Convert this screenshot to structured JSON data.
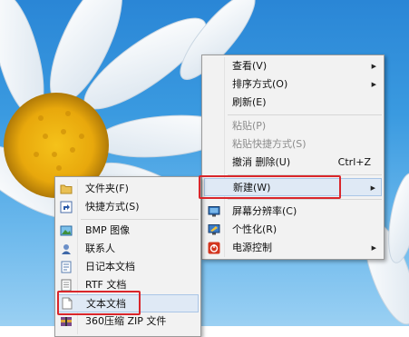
{
  "context_menu": {
    "items": [
      {
        "label": "查看(V)",
        "submenu": true
      },
      {
        "label": "排序方式(O)",
        "submenu": true
      },
      {
        "label": "刷新(E)"
      },
      {
        "label": "粘贴(P)",
        "disabled": true
      },
      {
        "label": "粘贴快捷方式(S)",
        "disabled": true
      },
      {
        "label": "撤消 删除(U)",
        "shortcut": "Ctrl+Z"
      },
      {
        "label": "新建(W)",
        "submenu": true,
        "highlighted": true
      },
      {
        "label": "屏幕分辨率(C)",
        "icon": "display-icon"
      },
      {
        "label": "个性化(R)",
        "icon": "personalize-icon"
      },
      {
        "label": "电源控制",
        "icon": "power-icon",
        "submenu": true
      }
    ]
  },
  "new_submenu": {
    "items": [
      {
        "label": "文件夹(F)",
        "icon": "folder-icon"
      },
      {
        "label": "快捷方式(S)",
        "icon": "shortcut-icon"
      },
      {
        "label": "BMP 图像",
        "icon": "bmp-image-icon"
      },
      {
        "label": "联系人",
        "icon": "contact-icon"
      },
      {
        "label": "日记本文档",
        "icon": "journal-icon"
      },
      {
        "label": "RTF 文档",
        "icon": "rtf-icon"
      },
      {
        "label": "文本文档",
        "icon": "text-document-icon",
        "highlighted": true
      },
      {
        "label": "360压缩 ZIP 文件",
        "icon": "zip-icon"
      }
    ]
  },
  "colors": {
    "highlight_box": "#d9262b",
    "menu_bg": "#f2f2f2",
    "hover": "#dfe9f5"
  }
}
